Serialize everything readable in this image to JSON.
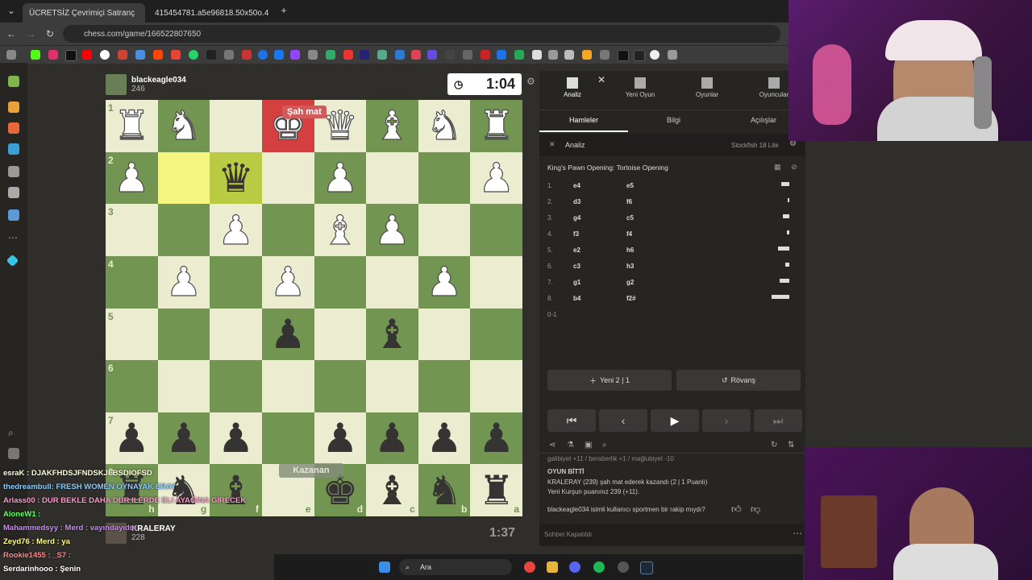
{
  "browser": {
    "tabs": [
      {
        "label": "ÜCRETSİZ Çevrimiçi Satranç",
        "active": true
      },
      {
        "label": "415454781.a5e96818.50x50o.4",
        "active": false
      }
    ],
    "url": "chess.com/game/166522807650"
  },
  "game": {
    "top_player": {
      "name": "blackeagle034",
      "rating": "246",
      "clock": "1:04"
    },
    "bottom_player": {
      "name": "KRALERAY",
      "rating": "228",
      "clock": "1:37"
    },
    "check_tag": "Şah mat",
    "winner_tag": "Kazanan",
    "board": [
      [
        "R",
        "N",
        "",
        "K",
        "Q",
        "B",
        "N",
        "R"
      ],
      [
        "P",
        "",
        "q",
        "",
        "P",
        "",
        "",
        "P"
      ],
      [
        "",
        "",
        "P",
        "",
        "B",
        "P",
        "",
        ""
      ],
      [
        "",
        "P",
        "",
        "P",
        "",
        "",
        "P",
        ""
      ],
      [
        "",
        "",
        "",
        "p",
        "",
        "b",
        "",
        ""
      ],
      [
        "",
        "",
        "",
        "",
        "",
        "",
        "",
        ""
      ],
      [
        "p",
        "p",
        "p",
        "",
        "p",
        "p",
        "p",
        "p"
      ],
      [
        "r",
        "n",
        "b",
        "",
        "k",
        "b",
        "n",
        "r"
      ]
    ],
    "ranks": [
      "1",
      "2",
      "3",
      "4",
      "5",
      "6",
      "7",
      "8"
    ],
    "files": [
      "h",
      "g",
      "f",
      "e",
      "d",
      "c",
      "b",
      "a"
    ]
  },
  "panel": {
    "tabs": [
      "Analiz",
      "Yeni Oyun",
      "Oyunlar",
      "Oyuncular"
    ],
    "subtabs": [
      "Hamleler",
      "Bilgi",
      "Açılışlar"
    ],
    "analysis_label": "Analiz",
    "engine": "Stockfish 18 Lite",
    "opening": "King's Pawn Opening: Tortoise Opening",
    "moves": [
      {
        "n": "1.",
        "w": "e4",
        "b": "e5",
        "bar": 10
      },
      {
        "n": "2.",
        "w": "d3",
        "b": "f6",
        "bar": 2
      },
      {
        "n": "3.",
        "w": "g4",
        "b": "c5",
        "bar": 8
      },
      {
        "n": "4.",
        "w": "f3",
        "b": "f4",
        "bar": 3
      },
      {
        "n": "5.",
        "w": "e2",
        "b": "h6",
        "bar": 14
      },
      {
        "n": "6.",
        "w": "c3",
        "b": "h3",
        "bar": 5
      },
      {
        "n": "7.",
        "w": "g1",
        "b": "g2",
        "bar": 12
      },
      {
        "n": "8.",
        "w": "b4",
        "b": "f2#",
        "bar": 22
      }
    ],
    "result": "0-1",
    "new_button": "Yeni 2 | 1",
    "rematch_button": "Rövanş",
    "chat": {
      "line0": "galibiyet +11 / beraberlik +1 / mağlubiyet -10",
      "title": "OYUN BİTTİ",
      "line1": "KRALERAY (239) şah mat ederek kazandı (2 | 1 Puanlı)",
      "line2": "Yeni Kurşun puanınız 239 (+11).",
      "sportsman": "blackeagle034 isimli kullanıcı sportmen bir rakip mıydı?",
      "closed": "Sohbet Kapatıldı"
    }
  },
  "overlay_chat": [
    "esraK : DJAKFHDSJFNDSKJFBSDIOFSD",
    "thedreambull: FRESH WOMEN OYNAYAK ERAY",
    "Arlass00 : DUR BEKLE DAHA DUR ILERDE ELI AYAĞINA GIRECEK",
    "AloneW1 :",
    "Mahammedsyy : Merd : vayındayıdm",
    "Zeyd76 : Merd : ya",
    "Rookie1455 : _S7 :",
    "Serdarinhooo : Şenin"
  ],
  "taskbar": {
    "search": "Ara"
  }
}
